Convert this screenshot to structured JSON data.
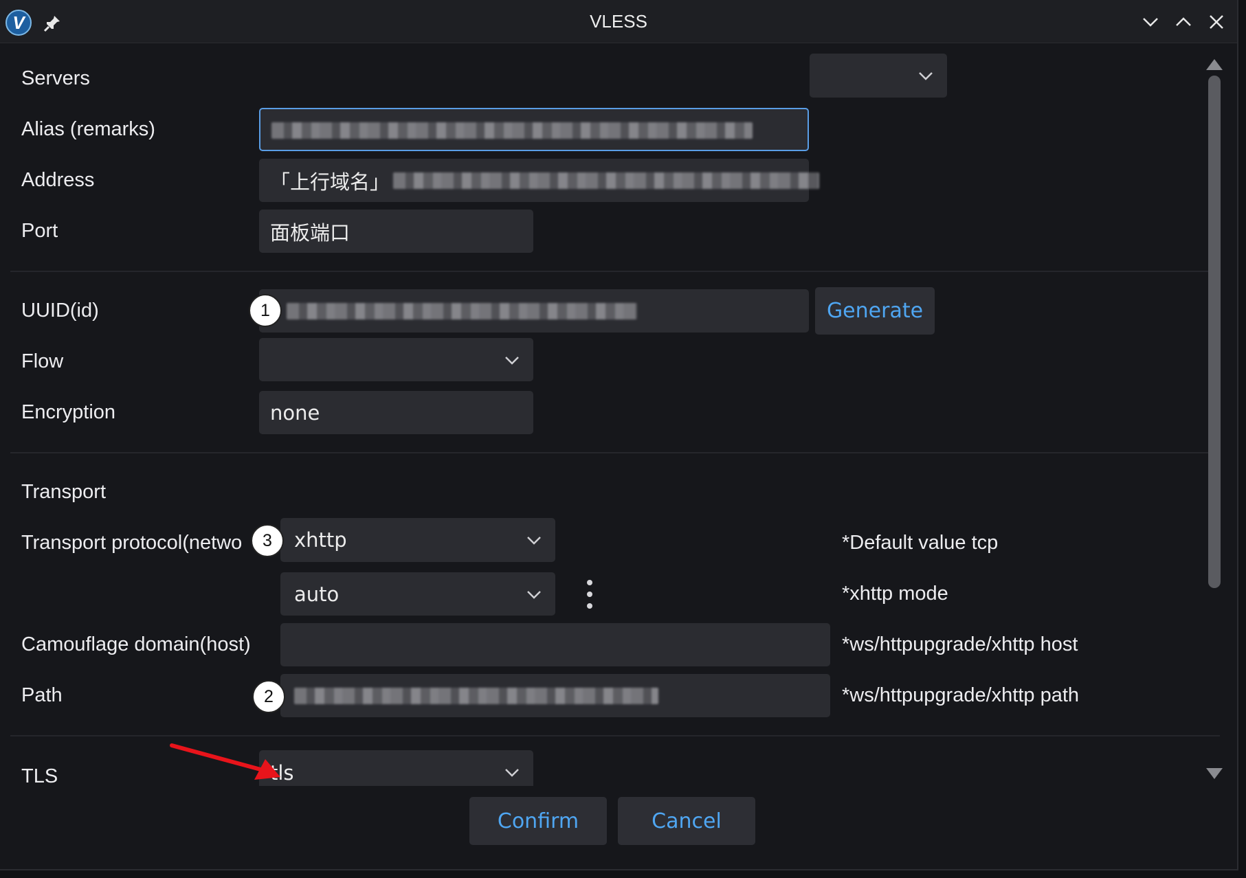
{
  "window": {
    "title": "VLESS",
    "logo_letter": "V"
  },
  "servers": {
    "label": "Servers",
    "selected": ""
  },
  "alias": {
    "label": "Alias (remarks)",
    "value": ""
  },
  "address": {
    "label": "Address",
    "value": "「上行域名」"
  },
  "port": {
    "label": "Port",
    "value": "面板端口"
  },
  "uuid": {
    "label": "UUID(id)",
    "value": "",
    "generate_label": "Generate"
  },
  "flow": {
    "label": "Flow",
    "selected": ""
  },
  "encryption": {
    "label": "Encryption",
    "value": "none"
  },
  "transport": {
    "section_label": "Transport",
    "protocol_label": "Transport protocol(netwo",
    "protocol_value": "xhttp",
    "protocol_hint": "*Default value tcp",
    "mode_value": "auto",
    "mode_hint": "*xhttp mode",
    "host_label": "Camouflage domain(host)",
    "host_value": "",
    "host_hint": "*ws/httpupgrade/xhttp host",
    "path_label": "Path",
    "path_value": "",
    "path_hint": "*ws/httpupgrade/xhttp path"
  },
  "tls": {
    "label": "TLS",
    "selected": "tls"
  },
  "actions": {
    "confirm_label": "Confirm",
    "cancel_label": "Cancel"
  },
  "annotations": {
    "badge_1": "1",
    "badge_2": "2",
    "badge_3": "3"
  },
  "colors": {
    "accent": "#4fa6f2",
    "background": "#16171b",
    "field": "#2b2c31",
    "arrow": "#e8141b"
  }
}
